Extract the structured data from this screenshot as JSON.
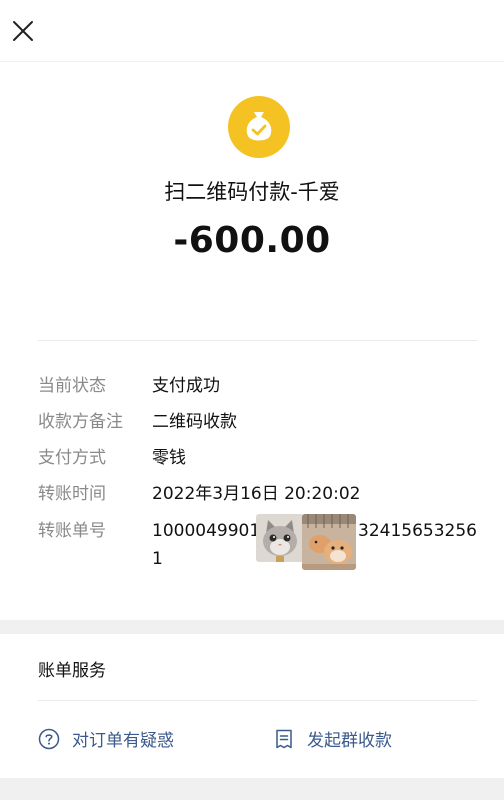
{
  "header": {
    "close_icon": "close-icon"
  },
  "payment": {
    "icon": "money-bag-check-icon",
    "merchant": "扫二维码付款-千爱",
    "amount": "-600.00",
    "icon_color": "#f5c223"
  },
  "details": [
    {
      "label": "当前状态",
      "value": "支付成功"
    },
    {
      "label": "收款方备注",
      "value": "二维码收款"
    },
    {
      "label": "支付方式",
      "value": "零钱"
    },
    {
      "label": "转账时间",
      "value": "2022年3月16日 20:20:02"
    }
  ],
  "order": {
    "label": "转账单号",
    "prefix": "1000049901",
    "suffix": "32415653256",
    "tail": "1",
    "sticker_1": "cat-sticker",
    "sticker_2": "hamster-sticker"
  },
  "service": {
    "title": "账单服务",
    "dispute_label": "对订单有疑惑",
    "dispute_icon": "question-circle-icon",
    "group_label": "发起群收款",
    "group_icon": "receipt-icon"
  },
  "colors": {
    "link": "#3b5a8c",
    "muted": "#8a8a8a"
  }
}
